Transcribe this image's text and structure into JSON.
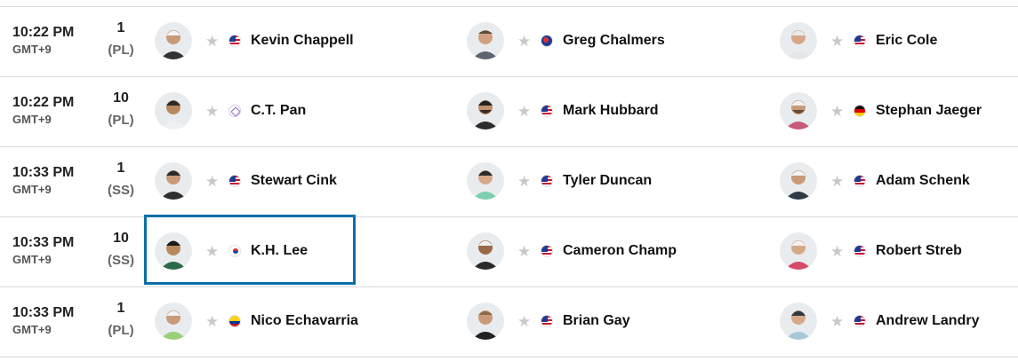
{
  "rows": [
    {
      "time": "10:22 PM",
      "tz": "GMT+9",
      "tee": "1",
      "course": "(PL)",
      "players": [
        {
          "name": "Kevin Chappell",
          "flag": "us",
          "star": "★"
        },
        {
          "name": "Greg Chalmers",
          "flag": "au",
          "star": "★"
        },
        {
          "name": "Eric Cole",
          "flag": "us",
          "star": "★"
        }
      ]
    },
    {
      "time": "10:22 PM",
      "tz": "GMT+9",
      "tee": "10",
      "course": "(PL)",
      "players": [
        {
          "name": "C.T. Pan",
          "flag": "tw",
          "star": "★"
        },
        {
          "name": "Mark Hubbard",
          "flag": "us",
          "star": "★"
        },
        {
          "name": "Stephan Jaeger",
          "flag": "de",
          "star": "★"
        }
      ]
    },
    {
      "time": "10:33 PM",
      "tz": "GMT+9",
      "tee": "1",
      "course": "(SS)",
      "players": [
        {
          "name": "Stewart Cink",
          "flag": "us",
          "star": "★"
        },
        {
          "name": "Tyler Duncan",
          "flag": "us",
          "star": "★"
        },
        {
          "name": "Adam Schenk",
          "flag": "us",
          "star": "★"
        }
      ]
    },
    {
      "time": "10:33 PM",
      "tz": "GMT+9",
      "tee": "10",
      "course": "(SS)",
      "players": [
        {
          "name": "K.H. Lee",
          "flag": "kr",
          "star": "★"
        },
        {
          "name": "Cameron Champ",
          "flag": "us",
          "star": "★"
        },
        {
          "name": "Robert Streb",
          "flag": "us",
          "star": "★"
        }
      ]
    },
    {
      "time": "10:33 PM",
      "tz": "GMT+9",
      "tee": "1",
      "course": "(PL)",
      "players": [
        {
          "name": "Nico Echavarria",
          "flag": "co",
          "star": "★"
        },
        {
          "name": "Brian Gay",
          "flag": "us",
          "star": "★"
        },
        {
          "name": "Andrew Landry",
          "flag": "us",
          "star": "★"
        }
      ]
    }
  ],
  "colors": {
    "highlight": "#0b6ea8",
    "divider": "#d9d9d9",
    "star": "#c8c8c8"
  }
}
